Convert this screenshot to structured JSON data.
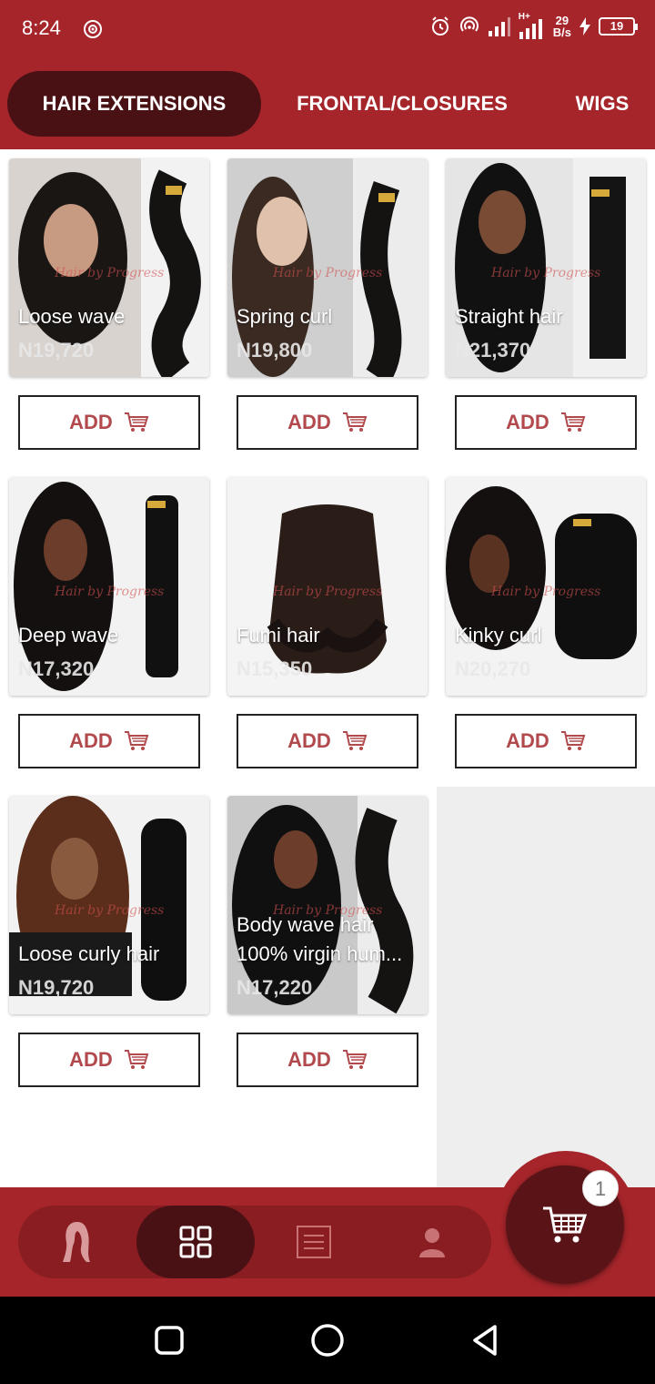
{
  "status_bar": {
    "time": "8:24",
    "net_speed_value": "29",
    "net_speed_unit": "B/s",
    "battery": "19",
    "network_label": "H+"
  },
  "tabs": [
    {
      "label": "HAIR EXTENSIONS",
      "active": true
    },
    {
      "label": "FRONTAL/CLOSURES",
      "active": false
    },
    {
      "label": "WIGS",
      "active": false
    }
  ],
  "watermark_text": "Hair by Progress",
  "add_label": "ADD",
  "products": [
    {
      "name": "Loose wave",
      "price": "N19,720"
    },
    {
      "name": "Spring curl",
      "price": "N19,800"
    },
    {
      "name": "Straight hair",
      "price": "N21,370"
    },
    {
      "name": "Deep wave",
      "price": "N17,320"
    },
    {
      "name": "Fumi hair",
      "price": "N15,350"
    },
    {
      "name": "Kinky curl",
      "price": "N20,270"
    },
    {
      "name": "Loose curly hair",
      "price": "N19,720"
    },
    {
      "name": "Body wave hair",
      "name_line2": "100% virgin hum...",
      "price": "N17,220"
    }
  ],
  "bottom_nav": [
    {
      "icon": "woman-silhouette-icon",
      "active": false
    },
    {
      "icon": "grid-icon",
      "active": true
    },
    {
      "icon": "list-icon",
      "active": false
    },
    {
      "icon": "profile-icon",
      "active": false
    }
  ],
  "cart": {
    "count": "1"
  },
  "colors": {
    "brand": "#a5252a",
    "brand_dark": "#4a1115",
    "add_text": "#b24a4d"
  }
}
